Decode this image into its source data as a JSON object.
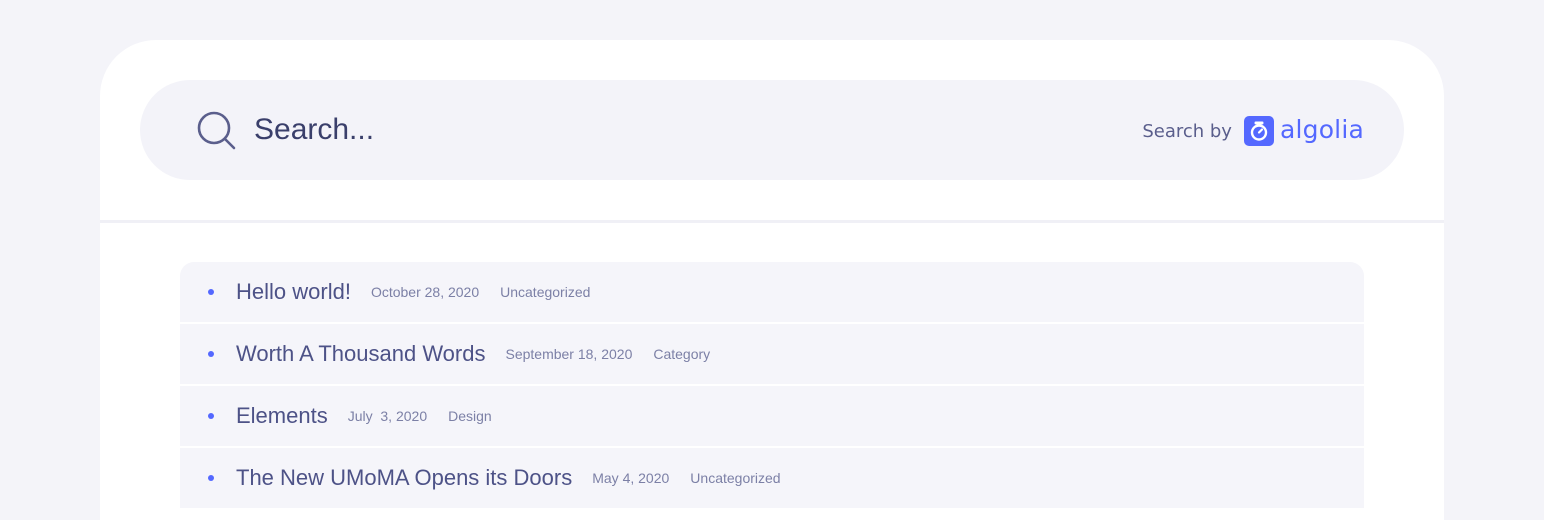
{
  "search": {
    "placeholder": "Search...",
    "powered_by_label": "Search by",
    "provider_name": "algolia"
  },
  "colors": {
    "page_background": "#f4f4f9",
    "card": "#ffffff",
    "search_bar": "#f3f3f9",
    "accent": "#5468ff",
    "title_text": "#4d5287",
    "meta_text": "#7c80a6"
  },
  "results": [
    {
      "title": "Hello world!",
      "date": "October 28, 2020",
      "category": "Uncategorized"
    },
    {
      "title": "Worth A Thousand Words",
      "date": "September 18, 2020",
      "category": "Category"
    },
    {
      "title": "Elements",
      "date": "July  3, 2020",
      "category": "Design"
    },
    {
      "title": "The New UMoMA Opens its Doors",
      "date": "May 4, 2020",
      "category": "Uncategorized"
    }
  ]
}
